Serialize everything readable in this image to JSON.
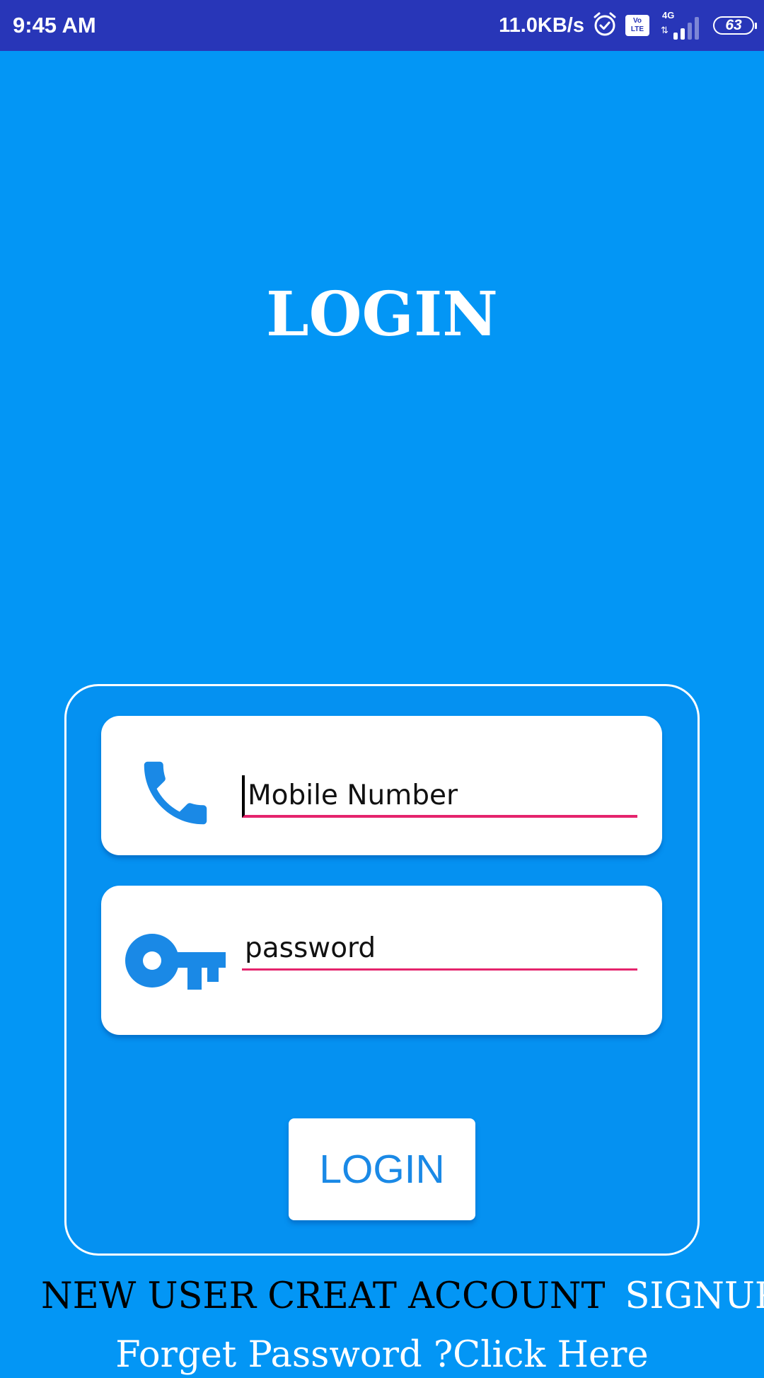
{
  "status_bar": {
    "time": "9:45 AM",
    "network_speed": "11.0KB/s",
    "volte_top": "Vo",
    "volte_bottom": "LTE",
    "network_type": "4G",
    "data_arrows": "⇅",
    "battery_level": "63",
    "icons": [
      "alarm-icon",
      "volte-icon",
      "signal-icon",
      "battery-icon"
    ]
  },
  "title": "LOGIN",
  "form": {
    "mobile": {
      "placeholder": "Mobile Number",
      "value": "",
      "icon": "phone-icon"
    },
    "password": {
      "placeholder": "password",
      "value": "",
      "icon": "key-icon"
    },
    "login_button": "LOGIN"
  },
  "footer": {
    "new_user_text": "NEW USER CREAT ACCOUNT",
    "signup_link": "SIGNUP",
    "forgot_password": "Forget Password ?Click Here"
  },
  "colors": {
    "background": "#0396f5",
    "status_bar": "#2836b8",
    "accent_blue": "#1a89e6",
    "input_underline": "#e5246d",
    "white": "#ffffff"
  }
}
